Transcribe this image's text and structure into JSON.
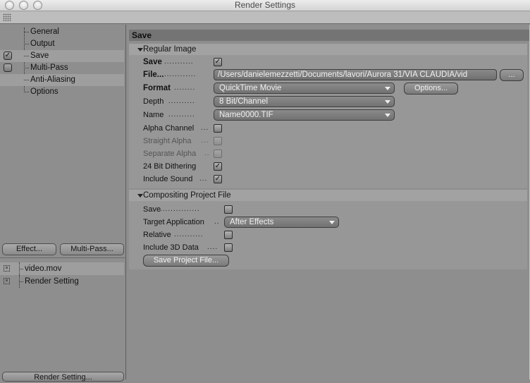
{
  "window": {
    "title": "Render Settings"
  },
  "left": {
    "nav_items": [
      {
        "label": "General",
        "checked": null
      },
      {
        "label": "Output",
        "checked": null
      },
      {
        "label": "Save",
        "checked": true
      },
      {
        "label": "Multi-Pass",
        "checked": false
      },
      {
        "label": "Anti-Aliasing",
        "checked": null
      },
      {
        "label": "Options",
        "checked": null
      }
    ],
    "effect_button": "Effect...",
    "multipass_button": "Multi-Pass...",
    "files": [
      {
        "label": "video.mov"
      },
      {
        "label": "Render Setting"
      }
    ],
    "render_setting_button": "Render Setting..."
  },
  "main": {
    "section_title": "Save",
    "regular_image": {
      "title": "Regular Image",
      "save_label": "Save",
      "save_dots": "...........",
      "save_checked": true,
      "file_label": "File...",
      "file_dots": "............",
      "file_path": "/Users/danielemezzetti/Documents/lavori/Aurora 31/VIA CLAUDIA/vid",
      "file_browse": "...",
      "format_label": "Format",
      "format_dots": "........",
      "format_value": "QuickTime Movie",
      "options_button": "Options...",
      "depth_label": "Depth",
      "depth_dots": "..........",
      "depth_value": "8 Bit/Channel",
      "name_label": "Name",
      "name_dots": "..........",
      "name_value": "Name0000.TIF",
      "alpha_channel_label": "Alpha Channel",
      "alpha_channel_dots": "...",
      "alpha_channel_checked": false,
      "straight_alpha_label": "Straight Alpha",
      "straight_alpha_dots": "...",
      "separate_alpha_label": "Separate Alpha",
      "separate_alpha_dots": "..",
      "dithering_label": "24 Bit Dithering",
      "dithering_checked": true,
      "include_sound_label": "Include Sound",
      "include_sound_dots": "...",
      "include_sound_checked": true
    },
    "compositing": {
      "title": "Compositing Project File",
      "save_label": "Save",
      "save_dots": "...............",
      "save_checked": false,
      "target_label": "Target Application",
      "target_dots": "..",
      "target_value": "After Effects",
      "relative_label": "Relative",
      "relative_dots": "...........",
      "relative_checked": false,
      "include3d_label": "Include 3D Data",
      "include3d_dots": "....",
      "include3d_checked": false,
      "save_project_button": "Save Project File..."
    }
  }
}
